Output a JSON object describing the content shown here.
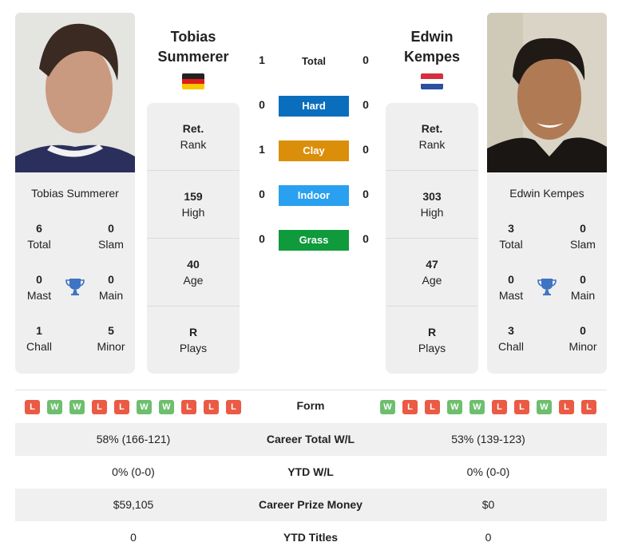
{
  "colors": {
    "hard": "#0a6ebd",
    "clay": "#db8e0a",
    "indoor": "#2aa0f0",
    "grass": "#0f9a3c",
    "win": "#6dbf6d",
    "loss": "#ea5a44",
    "trophy": "#3f74c2"
  },
  "player1": {
    "name_line1": "Tobias",
    "name_line2": "Summerer",
    "full_name": "Tobias Summerer",
    "flag": "germany-flag",
    "rank_value": "Ret.",
    "rank_label": "Rank",
    "high_value": "159",
    "high_label": "High",
    "age_value": "40",
    "age_label": "Age",
    "plays_value": "R",
    "plays_label": "Plays",
    "titles": {
      "total": "6",
      "total_label": "Total",
      "slam": "0",
      "slam_label": "Slam",
      "mast": "0",
      "mast_label": "Mast",
      "main": "0",
      "main_label": "Main",
      "chall": "1",
      "chall_label": "Chall",
      "minor": "5",
      "minor_label": "Minor"
    },
    "form": [
      "L",
      "W",
      "W",
      "L",
      "L",
      "W",
      "W",
      "L",
      "L",
      "L"
    ]
  },
  "player2": {
    "name_line1": "Edwin",
    "name_line2": "Kempes",
    "full_name": "Edwin Kempes",
    "flag": "netherlands-flag",
    "rank_value": "Ret.",
    "rank_label": "Rank",
    "high_value": "303",
    "high_label": "High",
    "age_value": "47",
    "age_label": "Age",
    "plays_value": "R",
    "plays_label": "Plays",
    "titles": {
      "total": "3",
      "total_label": "Total",
      "slam": "0",
      "slam_label": "Slam",
      "mast": "0",
      "mast_label": "Mast",
      "main": "0",
      "main_label": "Main",
      "chall": "3",
      "chall_label": "Chall",
      "minor": "0",
      "minor_label": "Minor"
    },
    "form": [
      "W",
      "L",
      "L",
      "W",
      "W",
      "L",
      "L",
      "W",
      "L",
      "L"
    ]
  },
  "h2h": [
    {
      "label": "Total",
      "p1": "1",
      "p2": "0"
    },
    {
      "label": "Hard",
      "p1": "0",
      "p2": "0"
    },
    {
      "label": "Clay",
      "p1": "1",
      "p2": "0"
    },
    {
      "label": "Indoor",
      "p1": "0",
      "p2": "0"
    },
    {
      "label": "Grass",
      "p1": "0",
      "p2": "0"
    }
  ],
  "comparison": {
    "form_label": "Form",
    "rows": [
      {
        "label": "Career Total W/L",
        "p1": "58% (166-121)",
        "p2": "53% (139-123)"
      },
      {
        "label": "YTD W/L",
        "p1": "0% (0-0)",
        "p2": "0% (0-0)"
      },
      {
        "label": "Career Prize Money",
        "p1": "$59,105",
        "p2": "$0"
      },
      {
        "label": "YTD Titles",
        "p1": "0",
        "p2": "0"
      }
    ]
  }
}
